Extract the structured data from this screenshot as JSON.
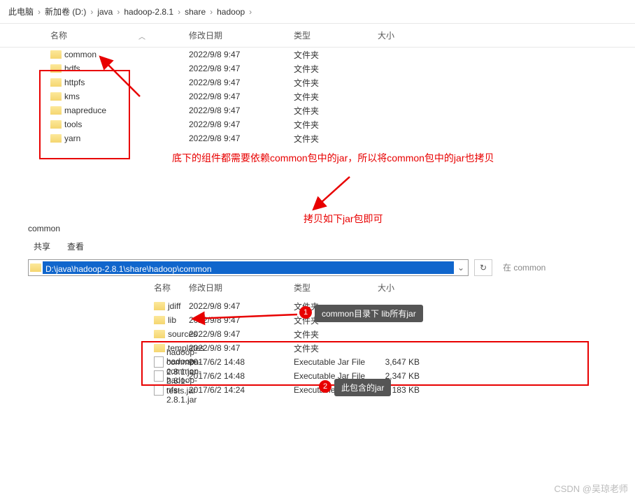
{
  "breadcrumb": {
    "items": [
      "此电脑",
      "新加卷 (D:)",
      "java",
      "hadoop-2.8.1",
      "share",
      "hadoop"
    ],
    "sep": "›"
  },
  "columns": {
    "name": "名称",
    "date": "修改日期",
    "type": "类型",
    "size": "大小"
  },
  "top_rows": [
    {
      "name": "common",
      "date": "2022/9/8 9:47",
      "type": "文件夹",
      "size": ""
    },
    {
      "name": "hdfs",
      "date": "2022/9/8 9:47",
      "type": "文件夹",
      "size": ""
    },
    {
      "name": "httpfs",
      "date": "2022/9/8 9:47",
      "type": "文件夹",
      "size": ""
    },
    {
      "name": "kms",
      "date": "2022/9/8 9:47",
      "type": "文件夹",
      "size": ""
    },
    {
      "name": "mapreduce",
      "date": "2022/9/8 9:47",
      "type": "文件夹",
      "size": ""
    },
    {
      "name": "tools",
      "date": "2022/9/8 9:47",
      "type": "文件夹",
      "size": ""
    },
    {
      "name": "yarn",
      "date": "2022/9/8 9:47",
      "type": "文件夹",
      "size": ""
    }
  ],
  "annotations": {
    "line1": "底下的组件都需要依赖common包中的jar，所以将common包中的jar也拷贝",
    "line2": "拷贝如下jar包即可",
    "callout1": "common目录下 lib所有jar",
    "callout2": "此包含的jar"
  },
  "bottom_window": {
    "title": "common",
    "tabs": [
      "共享",
      "查看"
    ],
    "address": "D:\\java\\hadoop-2.8.1\\share\\hadoop\\common",
    "search_prefix": "在 common"
  },
  "bottom_rows": [
    {
      "name": "jdiff",
      "date": "2022/9/8 9:47",
      "type": "文件夹",
      "size": "",
      "icon": "folder"
    },
    {
      "name": "lib",
      "date": "2022/9/8 9:47",
      "type": "文件夹",
      "size": "",
      "icon": "folder"
    },
    {
      "name": "sources",
      "date": "2022/9/8 9:47",
      "type": "文件夹",
      "size": "",
      "icon": "folder"
    },
    {
      "name": "templates",
      "date": "2022/9/8 9:47",
      "type": "文件夹",
      "size": "",
      "icon": "folder"
    },
    {
      "name": "hadoop-common-2.8.1.jar",
      "date": "2017/6/2 14:48",
      "type": "Executable Jar File",
      "size": "3,647 KB",
      "icon": "file"
    },
    {
      "name": "hadoop-common-2.8.1-tests.jar",
      "date": "2017/6/2 14:48",
      "type": "Executable Jar File",
      "size": "2,347 KB",
      "icon": "file"
    },
    {
      "name": "hadoop-nfs-2.8.1.jar",
      "date": "2017/6/2 14:24",
      "type": "Executable Jar File",
      "size": "183 KB",
      "icon": "file"
    }
  ],
  "watermark": "CSDN @吴琼老师"
}
